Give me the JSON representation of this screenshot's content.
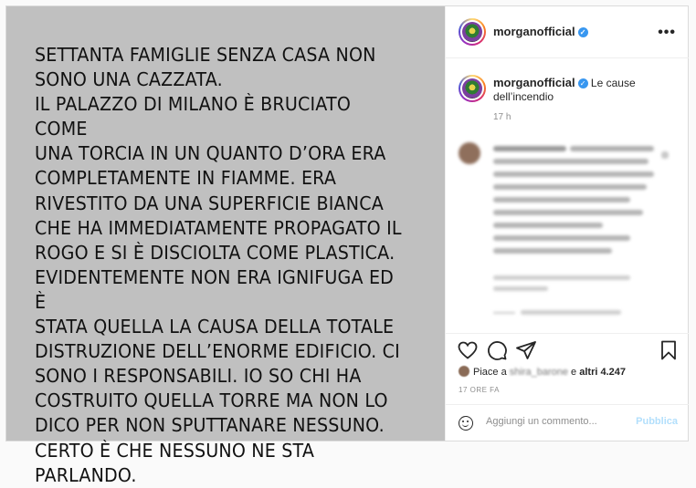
{
  "post": {
    "image_text": "SETTANTA FAMIGLIE SENZA CASA NON\nSONO UNA CAZZATA.\nIL PALAZZO DI MILANO È BRUCIATO COME\nUNA TORCIA IN UN QUANTO D’ORA ERA\nCOMPLETAMENTE IN FIAMME.  ERA\nRIVESTITO DA UNA SUPERFICIE BIANCA\nCHE HA IMMEDIATAMENTE PROPAGATO IL\nROGO E SI È DISCIOLTA COME PLASTICA.\nEVIDENTEMENTE NON ERA IGNIFUGA ED È\nSTATA QUELLA LA CAUSA DELLA TOTALE\nDISTRUZIONE DELL’ENORME EDIFICIO. CI\nSONO I RESPONSABILI. IO SO CHI HA\nCOSTRUITO QUELLA TORRE MA NON LO\nDICO PER NON SPUTTANARE NESSUNO.\nCERTO È CHE NESSUNO NE STA\nPARLANDO."
  },
  "header": {
    "username": "morganofficial",
    "verified_icon": "verified-badge-icon",
    "more_icon": "more-options-icon",
    "more_glyph": "•••"
  },
  "caption": {
    "username": "morganofficial",
    "text": "Le cause dell’incendio",
    "time": "17 h"
  },
  "actions": {
    "icons": [
      "heart-icon",
      "comment-icon",
      "share-icon",
      "bookmark-icon"
    ]
  },
  "likes": {
    "prefix": "Piace a",
    "blurred_user": "shira_barone",
    "conj": "e",
    "others": "altri 4.247"
  },
  "date": "17 ORE FA",
  "comment_box": {
    "placeholder": "Aggiungi un commento...",
    "publish": "Pubblica"
  },
  "colors": {
    "image_bg": "#c0c0c0",
    "verified": "#3897f0",
    "publish_disabled": "#b2dffc"
  }
}
